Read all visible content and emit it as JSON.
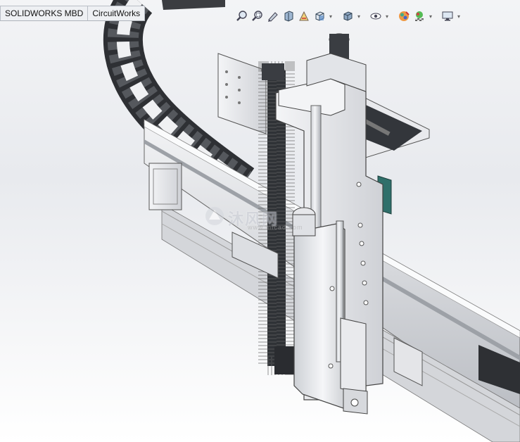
{
  "command_manager": {
    "tabs": [
      {
        "label": "SOLIDWORKS MBD"
      },
      {
        "label": "CircuitWorks"
      }
    ]
  },
  "heads_up_toolbar": {
    "buttons": [
      {
        "icon": "zoom-to-fit-icon"
      },
      {
        "icon": "zoom-to-area-icon"
      },
      {
        "icon": "previous-view-icon"
      },
      {
        "icon": "section-view-icon"
      },
      {
        "icon": "dynamic-annotation-views-icon"
      },
      {
        "icon": "view-orientation-icon"
      },
      {
        "icon": "display-style-icon"
      },
      {
        "icon": "hide-show-items-icon"
      },
      {
        "icon": "edit-appearance-icon"
      },
      {
        "icon": "apply-scene-icon"
      },
      {
        "icon": "view-settings-icon"
      }
    ]
  },
  "watermark": {
    "cn_text": "沐风网",
    "url_text": "www.mfcad.com"
  },
  "colors": {
    "background_top": "#f3f4f6",
    "background_bottom": "#ffffff",
    "part_light": "#e6e7ea",
    "part_mid": "#c8cacf",
    "cable_chain": "#3b3d41",
    "motor_accent": "#2f6f6a"
  }
}
